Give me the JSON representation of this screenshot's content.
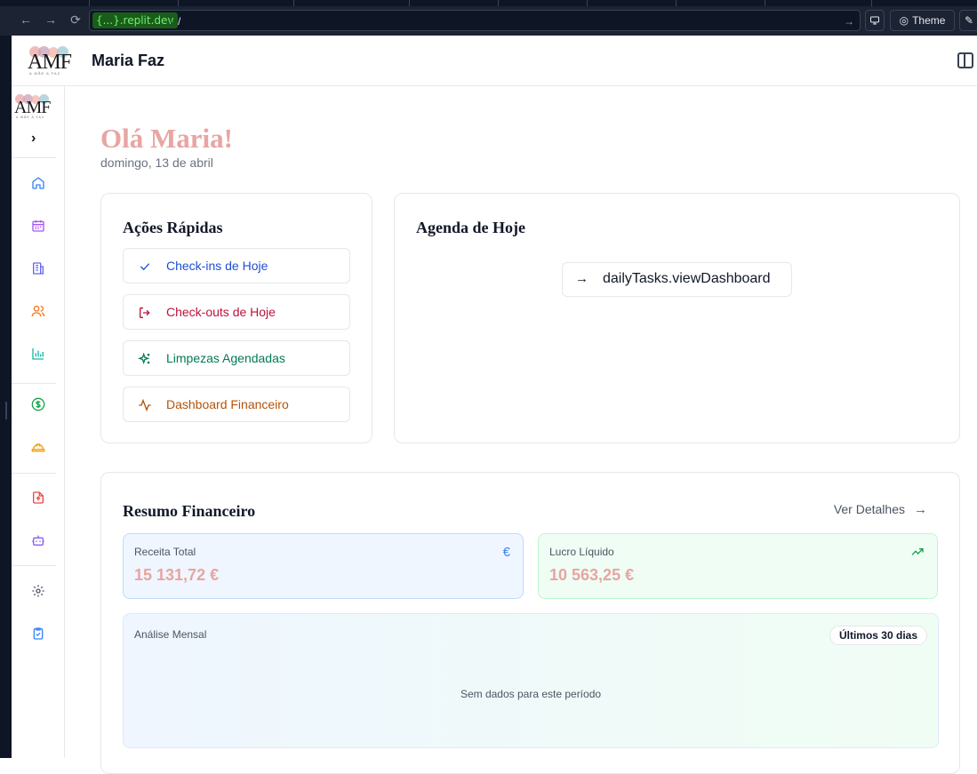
{
  "browser": {
    "url_host": "{...}.replit.dev",
    "url_path": "/",
    "theme_label": "Theme"
  },
  "app": {
    "logo_text": "AMF",
    "logo_tagline": "A MÃE A FAZ",
    "title": "Maria Faz"
  },
  "sidebar": {
    "items": [
      {
        "name": "home",
        "color": "#3b82f6"
      },
      {
        "name": "calendar",
        "color": "#a855f7"
      },
      {
        "name": "building",
        "color": "#6366f1"
      },
      {
        "name": "users",
        "color": "#f97316"
      },
      {
        "name": "bar-chart",
        "color": "#14b8a6"
      },
      {
        "name": "dollar",
        "color": "#16a34a"
      },
      {
        "name": "hard-hat",
        "color": "#f59e0b"
      },
      {
        "name": "file-upload",
        "color": "#ef4444"
      },
      {
        "name": "bot",
        "color": "#8b5cf6"
      },
      {
        "name": "settings",
        "color": "#4b5563"
      },
      {
        "name": "clipboard",
        "color": "#3b82f6"
      }
    ]
  },
  "greeting": {
    "title": "Olá Maria!",
    "date": "domingo, 13 de abril"
  },
  "quick_actions": {
    "title": "Ações Rápidas",
    "items": [
      {
        "label": "Check-ins de Hoje",
        "icon": "check-icon",
        "color": "#1d4ed8"
      },
      {
        "label": "Check-outs de Hoje",
        "icon": "logout-icon",
        "color": "#be123c"
      },
      {
        "label": "Limpezas Agendadas",
        "icon": "sparkles-icon",
        "color": "#047857"
      },
      {
        "label": "Dashboard Financeiro",
        "icon": "activity-icon",
        "color": "#b45309"
      }
    ]
  },
  "agenda": {
    "title": "Agenda de Hoje",
    "button_label": "dailyTasks.viewDashboard"
  },
  "finance": {
    "title": "Resumo Financeiro",
    "details_label": "Ver Detalhes",
    "revenue": {
      "label": "Receita Total",
      "value": "15 131,72 €",
      "icon": "€"
    },
    "profit": {
      "label": "Lucro Líquido",
      "value": "10 563,25 €",
      "icon": "trending-up-icon"
    },
    "monthly": {
      "label": "Análise Mensal",
      "period": "Últimos 30 dias",
      "empty": "Sem dados para este período"
    }
  }
}
